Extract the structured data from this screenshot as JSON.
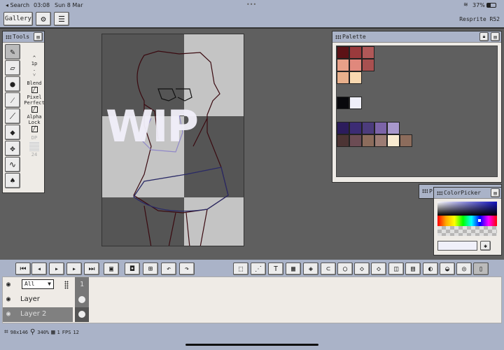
{
  "status_bar": {
    "back": "◂ Search",
    "time": "03:08",
    "date": "Sun 8 Mar",
    "dots": "•••",
    "wifi": "wifi-icon",
    "battery": "37%"
  },
  "toolbar": {
    "gallery": "Gallery",
    "app_title": "Resprite R52"
  },
  "tools": {
    "title": "Tools",
    "brush_size": "1p",
    "up": "^",
    "down": "˅",
    "dot": ".",
    "blend": "Blend",
    "pixel_perfect": "Pixel Perfect",
    "alpha_lock": "Alpha Lock",
    "dp": "DP",
    "dp_value": "24",
    "items": [
      "pencil",
      "eraser",
      "fill-circle",
      "magic-wand",
      "eyedropper",
      "bucket",
      "move",
      "curve",
      "smudge"
    ]
  },
  "canvas": {
    "watermark": "WIP"
  },
  "palette": {
    "title": "Palette",
    "rows": [
      [
        "#5c1216",
        "#9a3a3c",
        "#b05858"
      ],
      [
        "#e8a088",
        "#e0887c",
        "#a85050"
      ],
      [
        "#e8b08c",
        "#f8d8b0"
      ],
      [],
      [
        "#08080c",
        "#f0f0fa"
      ],
      [],
      [
        "#2c1c5c",
        "#3c2c74",
        "#4c3c7c",
        "#7c64a8",
        "#a898cc"
      ],
      [
        "#4c3434",
        "#6c4c54",
        "#8c6c5c",
        "#9c7c74",
        "#f8ead0",
        "#8c6c5c"
      ]
    ]
  },
  "color_picker": {
    "title": "ColorPicker",
    "hidden_panel_label": "P"
  },
  "timeline": {
    "filter": "All",
    "frame": "1",
    "layers": [
      {
        "name": "Layer"
      },
      {
        "name": "Layer 2",
        "selected": true
      }
    ]
  },
  "footer": {
    "size": "98x146",
    "zoom": "340%",
    "frames": "1",
    "fps_label": "FPS",
    "fps": "12"
  },
  "colors": {
    "chrome": "#aab3c8",
    "workspace": "#5f5f5f",
    "panel": "#eeebe6"
  }
}
